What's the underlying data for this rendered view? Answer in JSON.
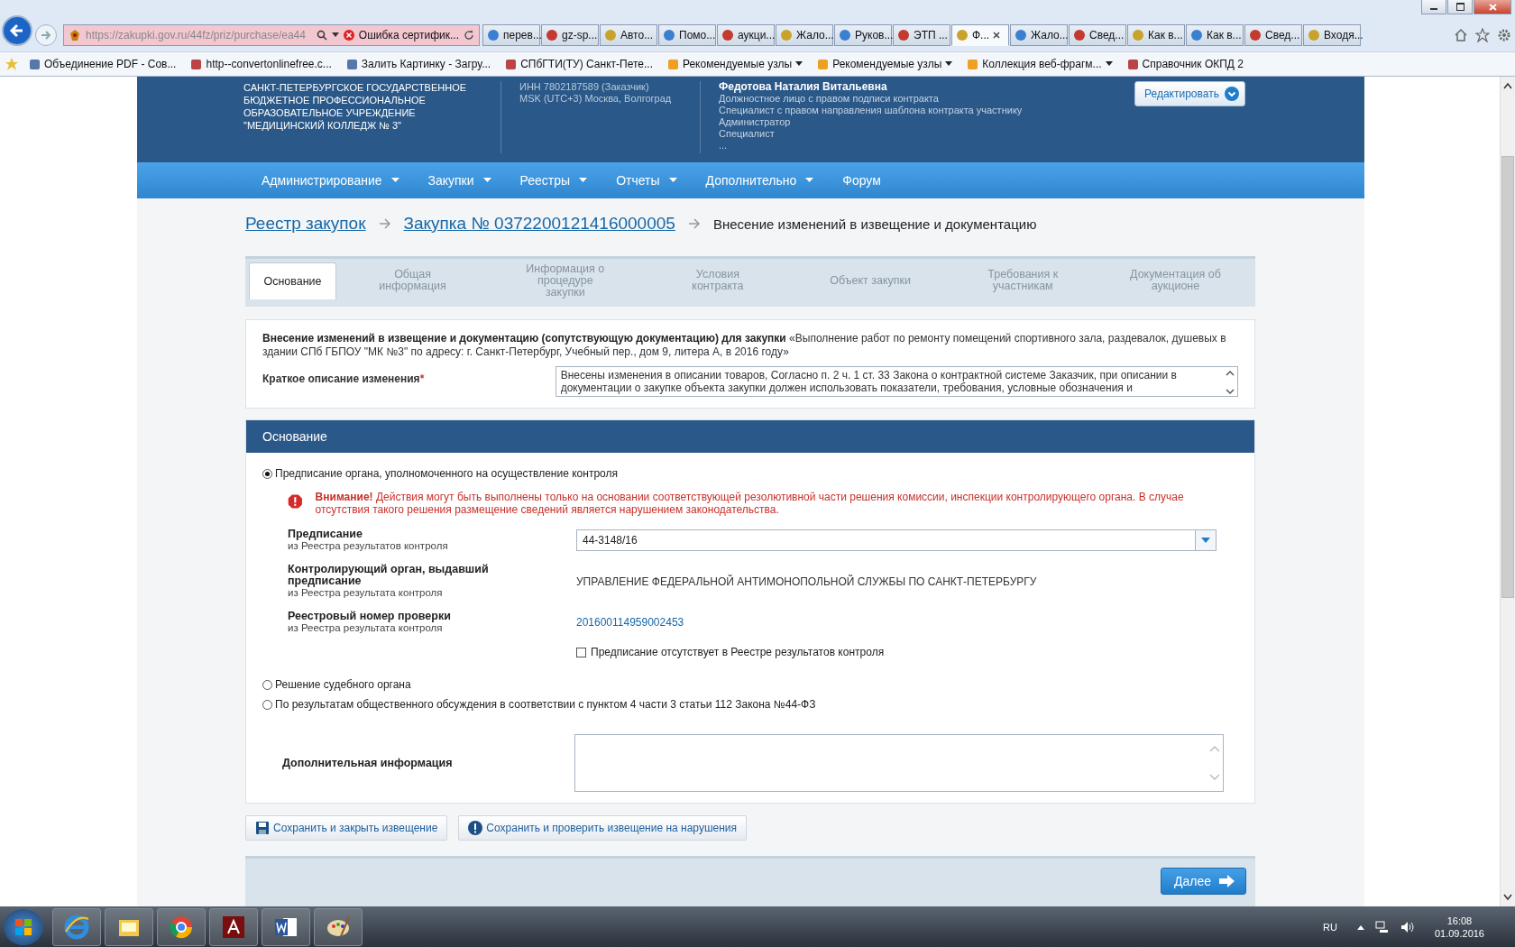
{
  "browser": {
    "address": "https://zakupki.gov.ru/44fz/priz/purchase/ea44",
    "cert_error": "Ошибка сертифик...",
    "tabs": [
      {
        "label": "перев...",
        "selected": false
      },
      {
        "label": "gz-sp...",
        "selected": false
      },
      {
        "label": "Авто...",
        "selected": false
      },
      {
        "label": "Помо...",
        "selected": false
      },
      {
        "label": "аукци...",
        "selected": false
      },
      {
        "label": "Жало...",
        "selected": false
      },
      {
        "label": "Руков...",
        "selected": false
      },
      {
        "label": "ЭТП ...",
        "selected": false
      },
      {
        "label": "Ф...",
        "selected": true
      },
      {
        "label": "Жало...",
        "selected": false
      },
      {
        "label": "Свед...",
        "selected": false
      },
      {
        "label": "Как в...",
        "selected": false
      },
      {
        "label": "Как в...",
        "selected": false
      },
      {
        "label": "Свед...",
        "selected": false
      },
      {
        "label": "Входя...",
        "selected": false
      }
    ]
  },
  "bookmarks": [
    {
      "label": "Объединение PDF - Сов...",
      "dropdown": false
    },
    {
      "label": "http--convertonlinefree.c...",
      "dropdown": false
    },
    {
      "label": "Залить Картинку - Загру...",
      "dropdown": false
    },
    {
      "label": "СПбГТИ(ТУ) Санкт-Пете...",
      "dropdown": false
    },
    {
      "label": "Рекомендуемые узлы",
      "dropdown": true
    },
    {
      "label": "Рекомендуемые узлы",
      "dropdown": true
    },
    {
      "label": "Коллекция веб-фрагм...",
      "dropdown": true
    },
    {
      "label": "Справочник ОКПД 2",
      "dropdown": false
    }
  ],
  "header": {
    "org": "САНКТ-ПЕТЕРБУРГСКОЕ ГОСУДАРСТВЕННОЕ БЮДЖЕТНОЕ ПРОФЕССИОНАЛЬНОЕ ОБРАЗОВАТЕЛЬНОЕ УЧРЕЖДЕНИЕ \"МЕДИЦИНСКИЙ КОЛЛЕДЖ № 3\"",
    "inn": "ИНН 7802187589 (Заказчик)",
    "timezone": "MSK (UTC+3) Москва, Волгоград",
    "user": "Федотова Наталия Витальевна",
    "roles": [
      "Должностное лицо с правом подписи контракта",
      "Специалист с правом направления шаблона контракта участнику",
      "Администратор",
      "Специалист",
      "..."
    ],
    "edit_button": "Редактировать"
  },
  "nav": [
    {
      "label": "Администрирование",
      "dropdown": true
    },
    {
      "label": "Закупки",
      "dropdown": true
    },
    {
      "label": "Реестры",
      "dropdown": true
    },
    {
      "label": "Отчеты",
      "dropdown": true
    },
    {
      "label": "Дополнительно",
      "dropdown": true
    },
    {
      "label": "Форум",
      "dropdown": false
    }
  ],
  "breadcrumb": [
    {
      "label": "Реестр закупок",
      "link": true
    },
    {
      "label": "Закупка № 0372200121416000005",
      "link": true
    },
    {
      "label": "Внесение изменений в извещение и документацию",
      "link": false
    }
  ],
  "form_tabs": [
    {
      "label": "Основание",
      "selected": true
    },
    {
      "label": "Общая информация",
      "selected": false
    },
    {
      "label": "Информация о процедуре закупки",
      "selected": false
    },
    {
      "label": "Условия контракта",
      "selected": false
    },
    {
      "label": "Объект закупки",
      "selected": false
    },
    {
      "label": "Требования к участникам",
      "selected": false
    },
    {
      "label": "Документация об аукционе",
      "selected": false
    }
  ],
  "intro": {
    "text": "**Внесение изменений в извещение и документацию (сопутствующую документацию) для закупки** «Выполнение работ по ремонту помещений спортивного зала, раздевалок, душевых в здании СПб ГБПОУ \"МК №3\" по адресу: г. Санкт-Петербург, Учебный пер., дом 9, литера А, в 2016 году»",
    "change_label": "Краткое описание изменения",
    "required_mark": "*",
    "change_value": "Внесены изменения в описании товаров, Согласно п. 2 ч. 1 ст. 33 Закона о контрактной системе Заказчик, при описании в документации о закупке объекта закупки должен использовать показатели, требования, условные обозначения и"
  },
  "section": {
    "title": "Основание",
    "options": [
      {
        "label": "Предписание органа, уполномоченного на осуществление контроля",
        "selected": true
      },
      {
        "label": "Решение судебного органа",
        "selected": false
      },
      {
        "label": "По результатам общественного обсуждения в соответствии с пунктом 4 части 3 статьи 112 Закона №44-ФЗ",
        "selected": false
      }
    ],
    "warning": "**Внимание!** Действия могут быть выполнены только на основании соответствующей резолютивной части решения комиссии, инспекции контролирующего органа. В случае отсутствия такого решения размещение сведений является нарушением законодательства.",
    "fields": [
      {
        "kind": "select",
        "label": "Предписание",
        "hint": "из Реестра результатов контроля",
        "value": "44-3148/16"
      },
      {
        "kind": "text",
        "label": "Контролирующий орган, выдавший предписание",
        "hint": "из Реестра результата контроля",
        "value": "УПРАВЛЕНИЕ ФЕДЕРАЛЬНОЙ АНТИМОНОПОЛЬНОЙ СЛУЖБЫ ПО САНКТ-ПЕТЕРБУРГУ"
      },
      {
        "kind": "link",
        "label": "Реестровый номер проверки",
        "hint": "из Реестра результата контроля",
        "value": "201600114959002453"
      }
    ],
    "missing": {
      "label": "Предписание отсутствует в Реестре результатов контроля",
      "checked": false
    },
    "extra_label": "Дополнительная информация"
  },
  "actions": [
    {
      "label": "Сохранить и закрыть извещение"
    },
    {
      "label": "Сохранить и проверить извещение на нарушения"
    }
  ],
  "next_button": "Далее",
  "taskbar": {
    "lang": "RU",
    "time": "16:08",
    "date": "01.09.2016"
  }
}
